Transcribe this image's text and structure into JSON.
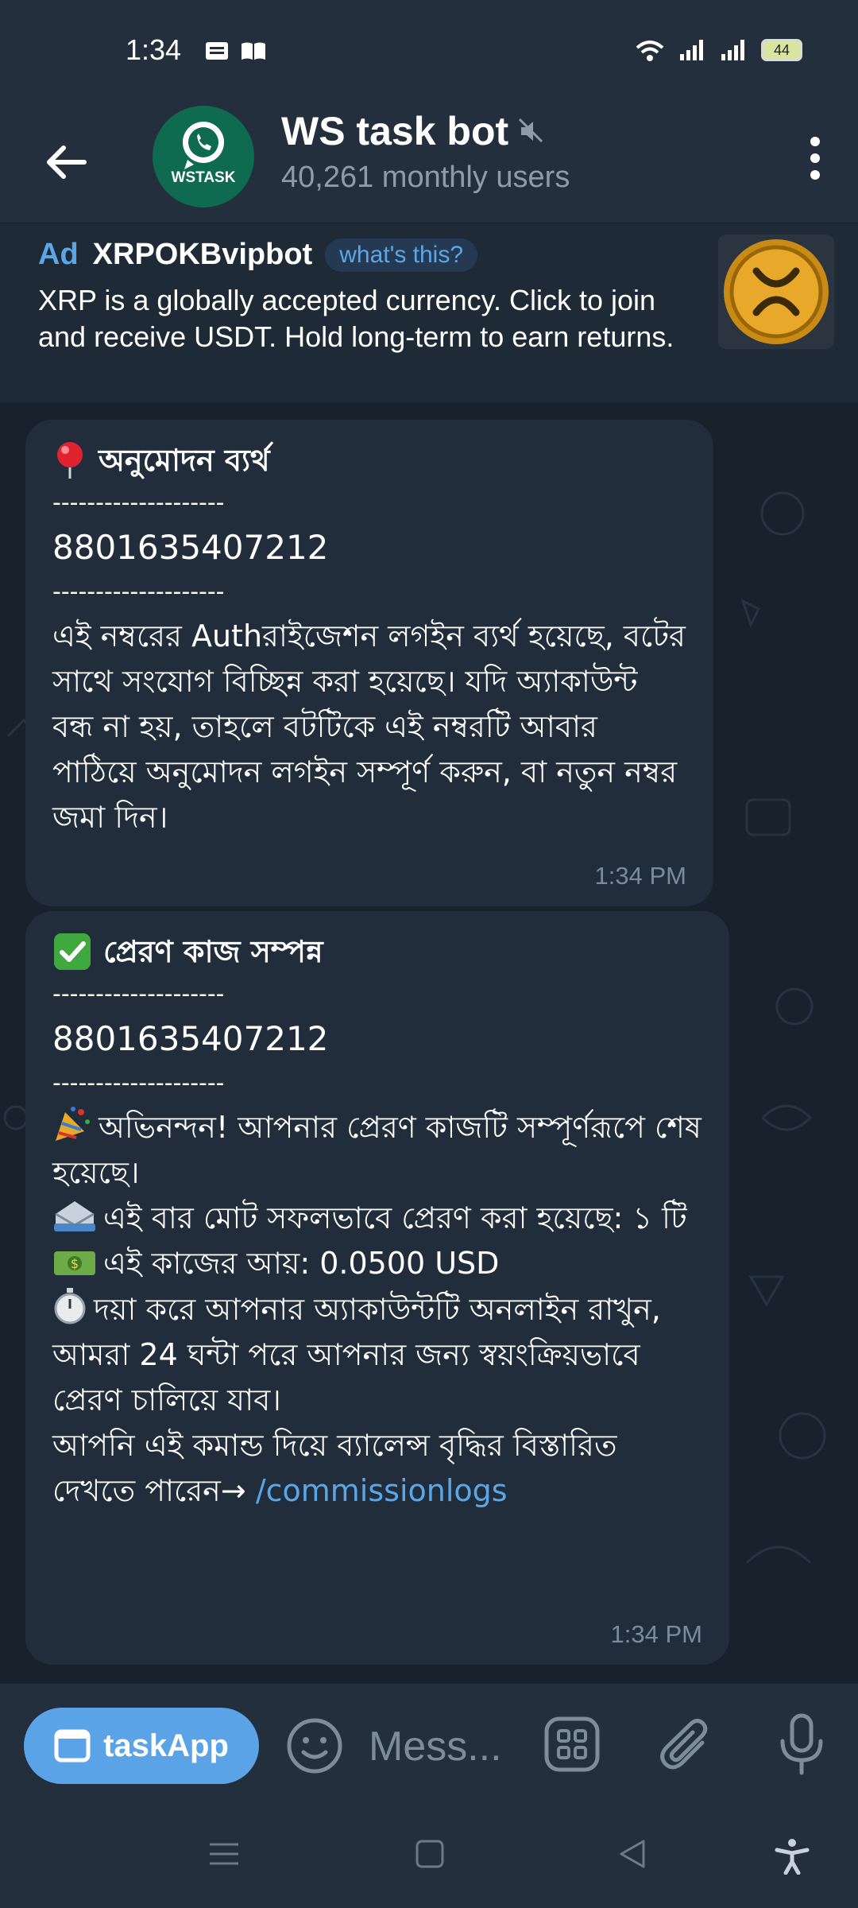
{
  "status_bar": {
    "time": "1:34",
    "battery": "44",
    "icons": [
      "news-icon",
      "book-icon",
      "wifi-icon",
      "signal-icon",
      "signal-icon",
      "battery-icon"
    ]
  },
  "header": {
    "title": "WS task bot",
    "subtitle": "40,261 monthly users",
    "avatar_label": "WSTASK",
    "brand_color": "#0f6b4f"
  },
  "ad": {
    "tag": "Ad",
    "name": "XRPOKBvipbot",
    "what_label": "what's this?",
    "text": "XRP is a globally accepted currency. Click to join and receive USDT. Hold long-term to earn returns."
  },
  "messages": [
    {
      "title": "অনুমোদন ব্যর্থ",
      "separator": "--------------------",
      "number": "8801635407212",
      "body": "এই নম্বরের Authরাইজেশন লগইন ব্যর্থ হয়েছে, বটের সাথে সংযোগ বিচ্ছিন্ন করা হয়েছে। যদি অ্যাকাউন্ট বন্ধ না হয়, তাহলে বটটিকে এই নম্বরটি আবার পাঠিয়ে অনুমোদন লগইন সম্পূর্ণ করুন, বা নতুন নম্বর জমা দিন।",
      "time": "1:34 PM"
    },
    {
      "title": "প্রেরণ কাজ সম্পন্ন",
      "separator": "--------------------",
      "number": "8801635407212",
      "line1": "অভিনন্দন! আপনার প্রেরণ কাজটি সম্পূর্ণরূপে শেষ হয়েছে।",
      "line2": "এই বার মোট সফলভাবে প্রেরণ করা হয়েছে: ১ টি",
      "line3": "এই কাজের আয়: 0.0500 USD",
      "line4": "দয়া করে আপনার অ্যাকাউন্টটি অনলাইন রাখুন, আমরা 24 ঘন্টা পরে আপনার জন্য স্বয়ংক্রিয়ভাবে প্রেরণ চালিয়ে যাব।",
      "line5": "আপনি এই কমান্ড দিয়ে ব্যালেন্স বৃদ্ধির বিস্তারিত দেখতে পারেন→",
      "link": "/commissionlogs",
      "time": "1:34 PM"
    }
  ],
  "input_bar": {
    "task_app_label": "taskApp",
    "placeholder": "Mess..."
  },
  "colors": {
    "accent": "#5ba6e6",
    "bubble": "#212d3b",
    "header": "#242f3d"
  }
}
